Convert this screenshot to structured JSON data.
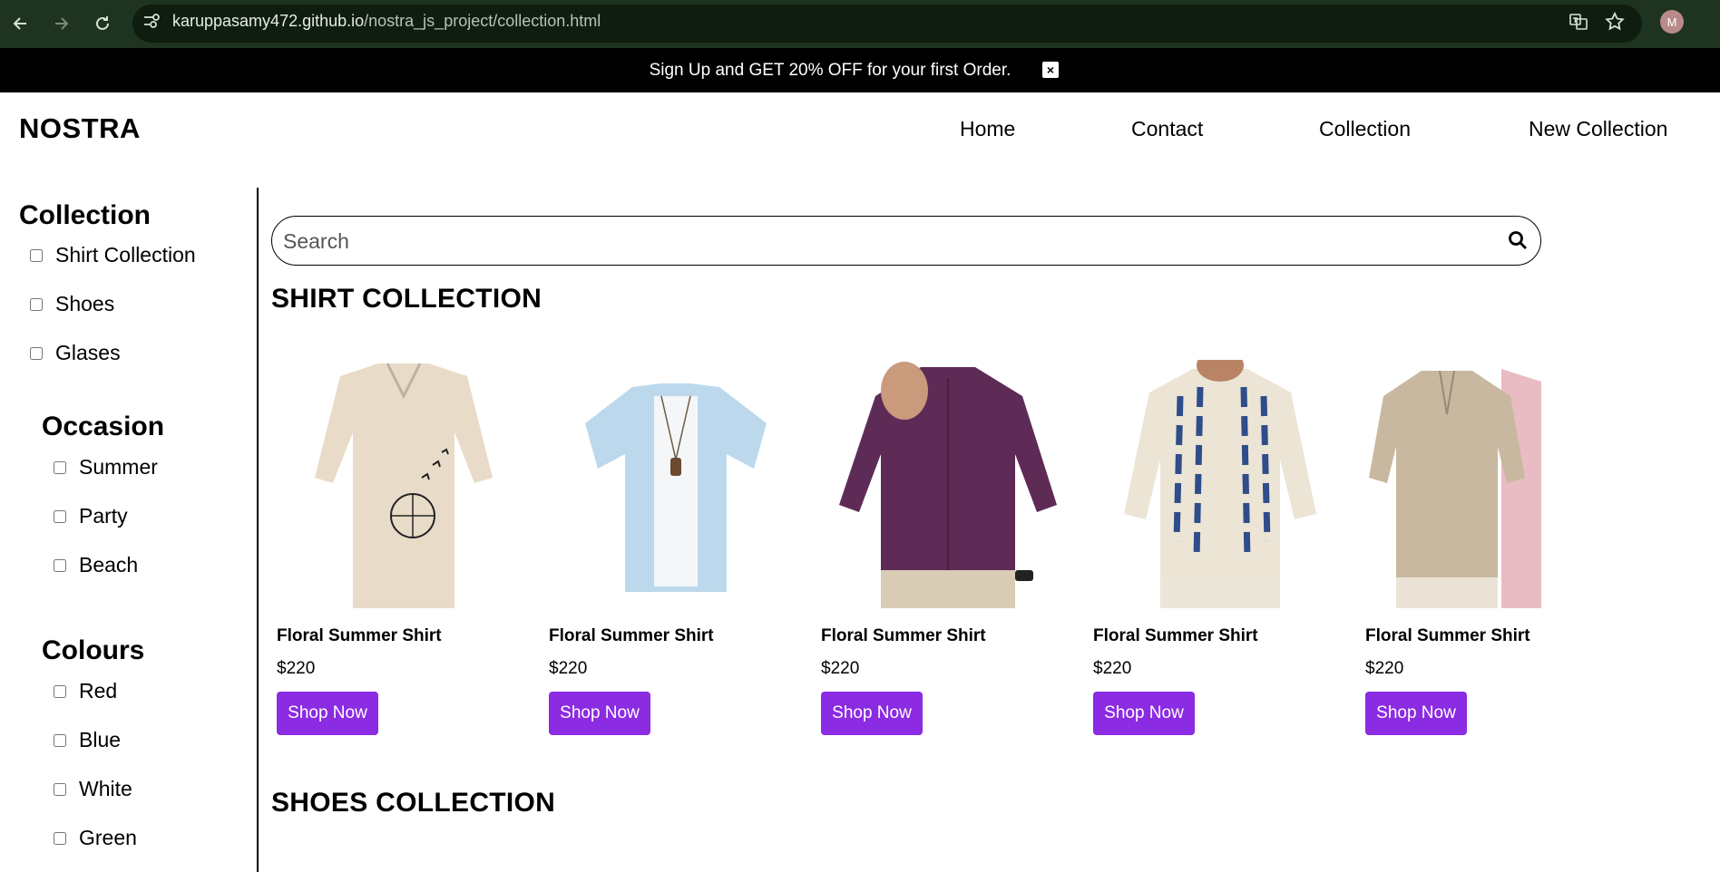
{
  "browser": {
    "url_host": "karuppasamy472.github.io",
    "url_path": "/nostra_js_project/collection.html",
    "profile_initial": "M"
  },
  "promo": {
    "text": "Sign Up and GET 20% OFF for your first Order.",
    "close_label": "×"
  },
  "header": {
    "logo": "NOSTRA",
    "menu": [
      "Home",
      "Contact",
      "Collection",
      "New Collection"
    ]
  },
  "sidebar": {
    "sections": [
      {
        "title": "Collection",
        "options": [
          "Shirt Collection",
          "Shoes",
          "Glases"
        ]
      },
      {
        "title": "Occasion",
        "options": [
          "Summer",
          "Party",
          "Beach"
        ]
      },
      {
        "title": "Colours",
        "options": [
          "Red",
          "Blue",
          "White",
          "Green"
        ]
      }
    ]
  },
  "search": {
    "placeholder": "Search"
  },
  "sections": {
    "shirt_title": "SHIRT COLLECTION",
    "shoes_title": "SHOES COLLECTION"
  },
  "products": [
    {
      "name": "Floral Summer Shirt",
      "price": "$220",
      "button": "Shop Now",
      "shirt_color": "#e8dcc8"
    },
    {
      "name": "Floral Summer Shirt",
      "price": "$220",
      "button": "Shop Now",
      "shirt_color": "#bcd8ec"
    },
    {
      "name": "Floral Summer Shirt",
      "price": "$220",
      "button": "Shop Now",
      "shirt_color": "#5e2b57"
    },
    {
      "name": "Floral Summer Shirt",
      "price": "$220",
      "button": "Shop Now",
      "shirt_color": "#ece5d6"
    },
    {
      "name": "Floral Summer Shirt",
      "price": "$220",
      "button": "Shop Now",
      "shirt_color": "#c8b8a0"
    }
  ],
  "colors": {
    "accent": "#8b2be2",
    "browser_bar": "#1e3320",
    "promo_bg": "#000000"
  }
}
